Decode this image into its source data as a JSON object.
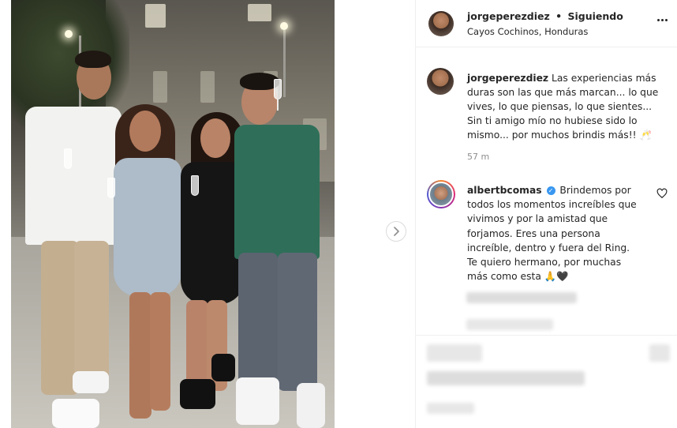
{
  "post": {
    "author": "jorgeperezdiez",
    "follow_status": "Siguiendo",
    "separator": "•",
    "location": "Cayos Cochinos, Honduras"
  },
  "caption": {
    "author": "jorgeperezdiez",
    "text": "Las experiencias más duras son las que más marcan... lo que vives, lo que piensas, lo que sientes... Sin ti amigo mío no hubiese sido lo mismo... por muchos brindis más!! 🥂",
    "time": "57 m"
  },
  "comments": [
    {
      "author": "albertbcomas",
      "verified_mark": "✓",
      "text": "Brindemos por todos los momentos increíbles que vivimos y por la amistad que forjamos. Eres una persona increíble, dentro y fuera del Ring. Te quiero hermano, por muchas más como esta 🙏🖤"
    }
  ],
  "icons": {
    "more": "more-options-icon",
    "next": "chevron-right-icon",
    "like": "heart-icon",
    "verified": "verified-badge-icon"
  },
  "colors": {
    "verified_blue": "#3897f0",
    "muted_text": "#8e8e8e",
    "border": "#efefef"
  }
}
